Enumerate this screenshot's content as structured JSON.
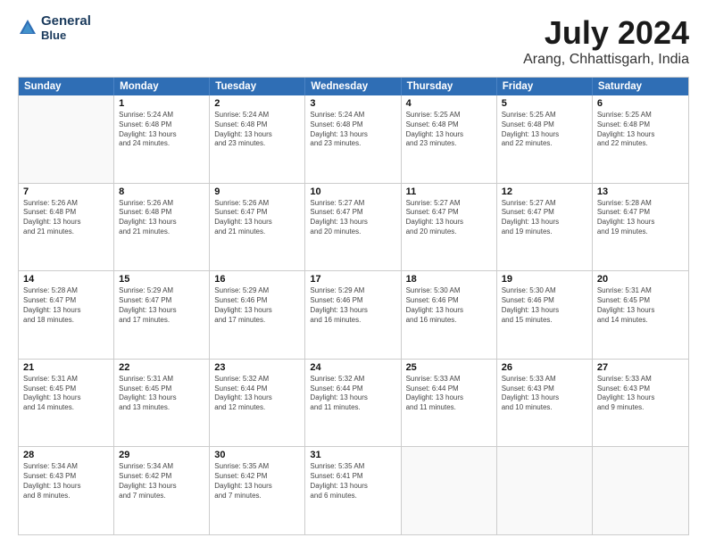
{
  "logo": {
    "line1": "General",
    "line2": "Blue"
  },
  "title": "July 2024",
  "subtitle": "Arang, Chhattisgarh, India",
  "headers": [
    "Sunday",
    "Monday",
    "Tuesday",
    "Wednesday",
    "Thursday",
    "Friday",
    "Saturday"
  ],
  "weeks": [
    [
      {
        "day": "",
        "lines": []
      },
      {
        "day": "1",
        "lines": [
          "Sunrise: 5:24 AM",
          "Sunset: 6:48 PM",
          "Daylight: 13 hours",
          "and 24 minutes."
        ]
      },
      {
        "day": "2",
        "lines": [
          "Sunrise: 5:24 AM",
          "Sunset: 6:48 PM",
          "Daylight: 13 hours",
          "and 23 minutes."
        ]
      },
      {
        "day": "3",
        "lines": [
          "Sunrise: 5:24 AM",
          "Sunset: 6:48 PM",
          "Daylight: 13 hours",
          "and 23 minutes."
        ]
      },
      {
        "day": "4",
        "lines": [
          "Sunrise: 5:25 AM",
          "Sunset: 6:48 PM",
          "Daylight: 13 hours",
          "and 23 minutes."
        ]
      },
      {
        "day": "5",
        "lines": [
          "Sunrise: 5:25 AM",
          "Sunset: 6:48 PM",
          "Daylight: 13 hours",
          "and 22 minutes."
        ]
      },
      {
        "day": "6",
        "lines": [
          "Sunrise: 5:25 AM",
          "Sunset: 6:48 PM",
          "Daylight: 13 hours",
          "and 22 minutes."
        ]
      }
    ],
    [
      {
        "day": "7",
        "lines": [
          "Sunrise: 5:26 AM",
          "Sunset: 6:48 PM",
          "Daylight: 13 hours",
          "and 21 minutes."
        ]
      },
      {
        "day": "8",
        "lines": [
          "Sunrise: 5:26 AM",
          "Sunset: 6:48 PM",
          "Daylight: 13 hours",
          "and 21 minutes."
        ]
      },
      {
        "day": "9",
        "lines": [
          "Sunrise: 5:26 AM",
          "Sunset: 6:47 PM",
          "Daylight: 13 hours",
          "and 21 minutes."
        ]
      },
      {
        "day": "10",
        "lines": [
          "Sunrise: 5:27 AM",
          "Sunset: 6:47 PM",
          "Daylight: 13 hours",
          "and 20 minutes."
        ]
      },
      {
        "day": "11",
        "lines": [
          "Sunrise: 5:27 AM",
          "Sunset: 6:47 PM",
          "Daylight: 13 hours",
          "and 20 minutes."
        ]
      },
      {
        "day": "12",
        "lines": [
          "Sunrise: 5:27 AM",
          "Sunset: 6:47 PM",
          "Daylight: 13 hours",
          "and 19 minutes."
        ]
      },
      {
        "day": "13",
        "lines": [
          "Sunrise: 5:28 AM",
          "Sunset: 6:47 PM",
          "Daylight: 13 hours",
          "and 19 minutes."
        ]
      }
    ],
    [
      {
        "day": "14",
        "lines": [
          "Sunrise: 5:28 AM",
          "Sunset: 6:47 PM",
          "Daylight: 13 hours",
          "and 18 minutes."
        ]
      },
      {
        "day": "15",
        "lines": [
          "Sunrise: 5:29 AM",
          "Sunset: 6:47 PM",
          "Daylight: 13 hours",
          "and 17 minutes."
        ]
      },
      {
        "day": "16",
        "lines": [
          "Sunrise: 5:29 AM",
          "Sunset: 6:46 PM",
          "Daylight: 13 hours",
          "and 17 minutes."
        ]
      },
      {
        "day": "17",
        "lines": [
          "Sunrise: 5:29 AM",
          "Sunset: 6:46 PM",
          "Daylight: 13 hours",
          "and 16 minutes."
        ]
      },
      {
        "day": "18",
        "lines": [
          "Sunrise: 5:30 AM",
          "Sunset: 6:46 PM",
          "Daylight: 13 hours",
          "and 16 minutes."
        ]
      },
      {
        "day": "19",
        "lines": [
          "Sunrise: 5:30 AM",
          "Sunset: 6:46 PM",
          "Daylight: 13 hours",
          "and 15 minutes."
        ]
      },
      {
        "day": "20",
        "lines": [
          "Sunrise: 5:31 AM",
          "Sunset: 6:45 PM",
          "Daylight: 13 hours",
          "and 14 minutes."
        ]
      }
    ],
    [
      {
        "day": "21",
        "lines": [
          "Sunrise: 5:31 AM",
          "Sunset: 6:45 PM",
          "Daylight: 13 hours",
          "and 14 minutes."
        ]
      },
      {
        "day": "22",
        "lines": [
          "Sunrise: 5:31 AM",
          "Sunset: 6:45 PM",
          "Daylight: 13 hours",
          "and 13 minutes."
        ]
      },
      {
        "day": "23",
        "lines": [
          "Sunrise: 5:32 AM",
          "Sunset: 6:44 PM",
          "Daylight: 13 hours",
          "and 12 minutes."
        ]
      },
      {
        "day": "24",
        "lines": [
          "Sunrise: 5:32 AM",
          "Sunset: 6:44 PM",
          "Daylight: 13 hours",
          "and 11 minutes."
        ]
      },
      {
        "day": "25",
        "lines": [
          "Sunrise: 5:33 AM",
          "Sunset: 6:44 PM",
          "Daylight: 13 hours",
          "and 11 minutes."
        ]
      },
      {
        "day": "26",
        "lines": [
          "Sunrise: 5:33 AM",
          "Sunset: 6:43 PM",
          "Daylight: 13 hours",
          "and 10 minutes."
        ]
      },
      {
        "day": "27",
        "lines": [
          "Sunrise: 5:33 AM",
          "Sunset: 6:43 PM",
          "Daylight: 13 hours",
          "and 9 minutes."
        ]
      }
    ],
    [
      {
        "day": "28",
        "lines": [
          "Sunrise: 5:34 AM",
          "Sunset: 6:43 PM",
          "Daylight: 13 hours",
          "and 8 minutes."
        ]
      },
      {
        "day": "29",
        "lines": [
          "Sunrise: 5:34 AM",
          "Sunset: 6:42 PM",
          "Daylight: 13 hours",
          "and 7 minutes."
        ]
      },
      {
        "day": "30",
        "lines": [
          "Sunrise: 5:35 AM",
          "Sunset: 6:42 PM",
          "Daylight: 13 hours",
          "and 7 minutes."
        ]
      },
      {
        "day": "31",
        "lines": [
          "Sunrise: 5:35 AM",
          "Sunset: 6:41 PM",
          "Daylight: 13 hours",
          "and 6 minutes."
        ]
      },
      {
        "day": "",
        "lines": []
      },
      {
        "day": "",
        "lines": []
      },
      {
        "day": "",
        "lines": []
      }
    ]
  ]
}
